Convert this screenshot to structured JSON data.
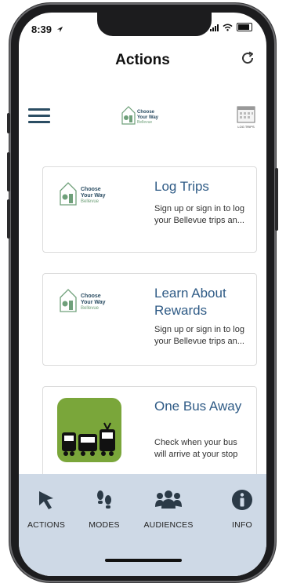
{
  "status_bar": {
    "time": "8:39"
  },
  "header": {
    "title": "Actions"
  },
  "cards": [
    {
      "title": "Log Trips",
      "description": "Sign up or sign in to log your Bellevue trips an..."
    },
    {
      "title": "Learn About Rewards",
      "description": "Sign up or sign in to log your Bellevue trips an..."
    },
    {
      "title": "One Bus Away",
      "description": "Check when your bus will arrive at your stop"
    }
  ],
  "brand": {
    "line1": "Choose",
    "line2": "Your Way",
    "line3": "Bellevue"
  },
  "logtrips_icon_label": "LOG TRIPS",
  "bottom_nav": [
    {
      "label": "ACTIONS",
      "icon": "cursor-arrow-icon"
    },
    {
      "label": "MODES",
      "icon": "footsteps-icon"
    },
    {
      "label": "AUDIENCES",
      "icon": "people-group-icon"
    },
    {
      "label": "INFO",
      "icon": "info-circle-icon"
    }
  ],
  "colors": {
    "nav_bg": "#ced9e6",
    "card_title": "#2f5b86",
    "oba_green": "#7aa63a"
  }
}
